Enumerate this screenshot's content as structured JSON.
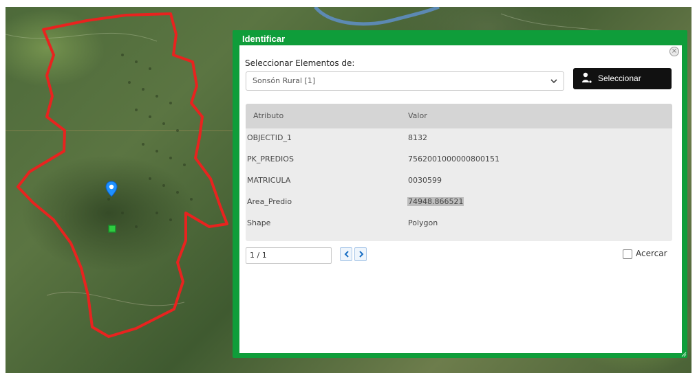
{
  "dialog": {
    "title": "Identificar",
    "close_icon": "close-icon"
  },
  "selector": {
    "label": "Seleccionar Elementos de:",
    "layer_value": "Sonsón Rural [1]",
    "button_label": "Seleccionar",
    "button_icon": "select-features-icon"
  },
  "attributes": {
    "headers": {
      "attribute": "Atributo",
      "value": "Valor"
    },
    "rows": [
      {
        "attribute": "OBJECTID_1",
        "value": "8132"
      },
      {
        "attribute": "PK_PREDIOS",
        "value": "7562001000000800151"
      },
      {
        "attribute": "MATRICULA",
        "value": "0030599"
      },
      {
        "attribute": "Area_Predio",
        "value": "74948.866521"
      },
      {
        "attribute": "Shape",
        "value": "Polygon"
      }
    ]
  },
  "pagination": {
    "page_value": "1 / 1",
    "prev_icon": "chevron-left-icon",
    "next_icon": "chevron-right-icon"
  },
  "zoom": {
    "label": "Acercar",
    "checked": false
  },
  "map": {
    "parcel_outline_color": "#e8231f",
    "dialog_color": "#0f9d3a",
    "marker_icon": "location-pin-icon",
    "marker_color": "#1e90ff",
    "point_icon": "green-square-marker-icon"
  }
}
